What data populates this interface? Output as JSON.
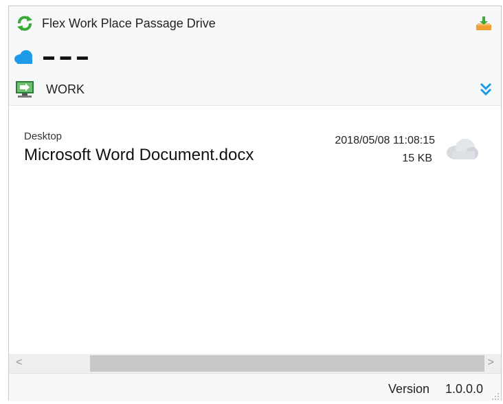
{
  "app": {
    "title": "Flex Work Place Passage Drive",
    "icon": "sync-arrows-icon",
    "upload_icon": "upload-tray-icon"
  },
  "account": {
    "icon": "cloud-icon",
    "name": "▬ ▬  ▬"
  },
  "workspace": {
    "icon": "computer-icon",
    "label": "WORK",
    "expand_icon": "double-chevron-down-icon"
  },
  "files": [
    {
      "location": "Desktop",
      "name": "Microsoft Word Document.docx",
      "modified": "2018/05/08 11:08:15",
      "size": "15  KB",
      "status_icon": "cloud-status-icon"
    }
  ],
  "scrollbar": {
    "left": "<",
    "right": ">"
  },
  "status": {
    "version_label": "Version",
    "version_value": "1.0.0.0"
  },
  "colors": {
    "accent_blue": "#1e9be8",
    "sync_green": "#3aaa35",
    "upload_orange": "#f0a030"
  }
}
